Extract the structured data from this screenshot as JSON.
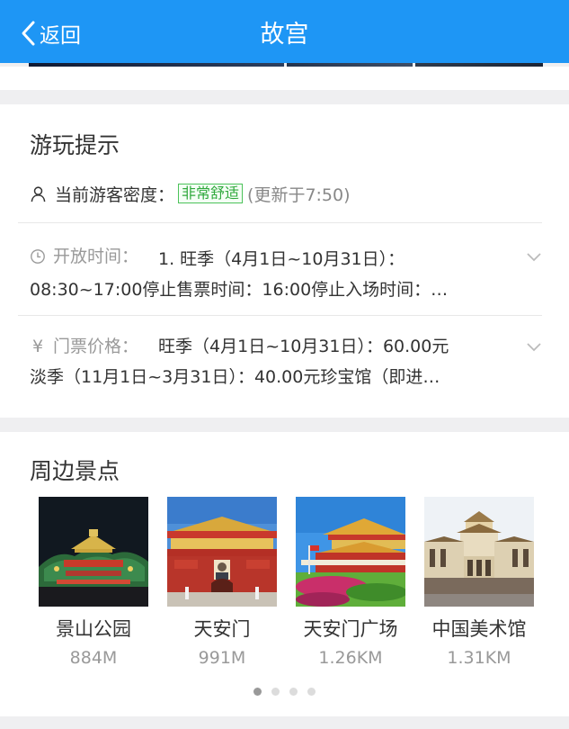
{
  "header": {
    "back_label": "返回",
    "title": "故宫"
  },
  "tips": {
    "title": "游玩提示",
    "density_label": "当前游客密度：",
    "density_badge": "非常舒适",
    "density_updated": "(更新于7:50)",
    "hours_label": "开放时间：",
    "hours_line1": "1. 旺季（4月1日~10月31日）：",
    "hours_line2": "08:30~17:00停止售票时间：16:00停止入场时间：…",
    "price_symbol": "¥",
    "price_label": "门票价格：",
    "price_line1": "旺季（4月1日~10月31日）：60.00元",
    "price_line2": "淡季（11月1日~3月31日）：40.00元珍宝馆（即进…"
  },
  "nearby": {
    "title": "周边景点",
    "spots": [
      {
        "name": "景山公园",
        "distance": "884M",
        "image": "jingshan-park-night"
      },
      {
        "name": "天安门",
        "distance": "991M",
        "image": "tiananmen-gate"
      },
      {
        "name": "天安门广场",
        "distance": "1.26KM",
        "image": "tiananmen-square"
      },
      {
        "name": "中国美术馆",
        "distance": "1.31KM",
        "image": "national-art-museum"
      }
    ],
    "page_count": 4,
    "active_page": 1
  },
  "colors": {
    "header_bg": "#1e96f5",
    "badge_green": "#2fa83c"
  }
}
